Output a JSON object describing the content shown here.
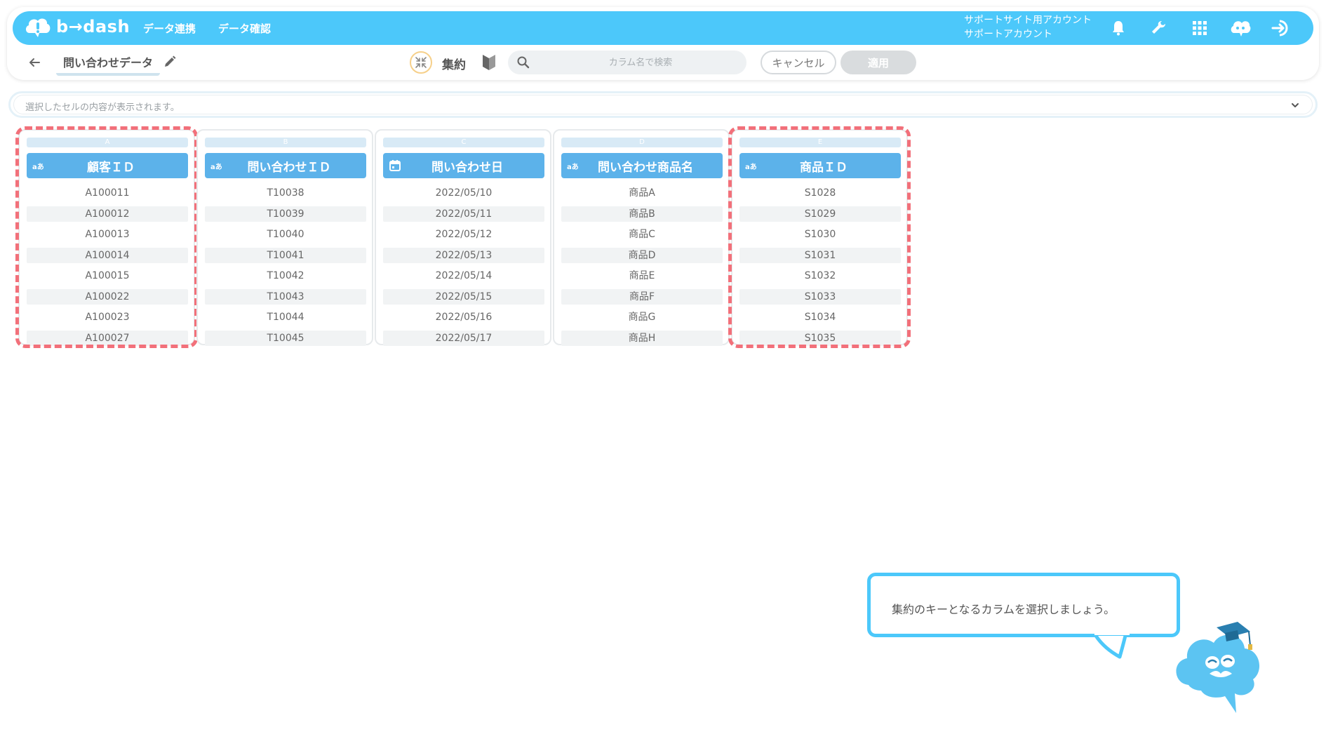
{
  "header": {
    "logo_text": "b→dash",
    "nav": [
      "データ連携",
      "データ確認"
    ],
    "account_line1": "サポートサイト用アカウント",
    "account_line2": "サポートアカウント",
    "accent_color": "#4cc8fa"
  },
  "toolbar": {
    "dataset_title": "問い合わせデータ",
    "mode_label": "集約",
    "search_placeholder": "カラム名で検索",
    "cancel_label": "キャンセル",
    "apply_label": "適用"
  },
  "cell_bar": {
    "placeholder": "選択したセルの内容が表示されます。"
  },
  "columns": [
    {
      "letter": "A",
      "type": "aあ",
      "title": "顧客ＩＤ",
      "highlighted": true,
      "values": [
        "A100011",
        "A100012",
        "A100013",
        "A100014",
        "A100015",
        "A100022",
        "A100023",
        "A100027"
      ]
    },
    {
      "letter": "B",
      "type": "aあ",
      "title": "問い合わせＩＤ",
      "highlighted": false,
      "values": [
        "T10038",
        "T10039",
        "T10040",
        "T10041",
        "T10042",
        "T10043",
        "T10044",
        "T10045"
      ]
    },
    {
      "letter": "C",
      "type": "calendar-icon",
      "title": "問い合わせ日",
      "highlighted": false,
      "values": [
        "2022/05/10",
        "2022/05/11",
        "2022/05/12",
        "2022/05/13",
        "2022/05/14",
        "2022/05/15",
        "2022/05/16",
        "2022/05/17"
      ]
    },
    {
      "letter": "D",
      "type": "aあ",
      "title": "問い合わせ商品名",
      "highlighted": false,
      "values": [
        "商品A",
        "商品B",
        "商品C",
        "商品D",
        "商品E",
        "商品F",
        "商品G",
        "商品H"
      ]
    },
    {
      "letter": "E",
      "type": "aあ",
      "title": "商品ＩＤ",
      "highlighted": true,
      "values": [
        "S1028",
        "S1029",
        "S1030",
        "S1031",
        "S1032",
        "S1033",
        "S1034",
        "S1035"
      ]
    }
  ],
  "guide": {
    "message": "集約のキーとなるカラムを選択しましょう。"
  },
  "colors": {
    "column_header": "#5cb2ea",
    "highlight": "#f2707a"
  }
}
